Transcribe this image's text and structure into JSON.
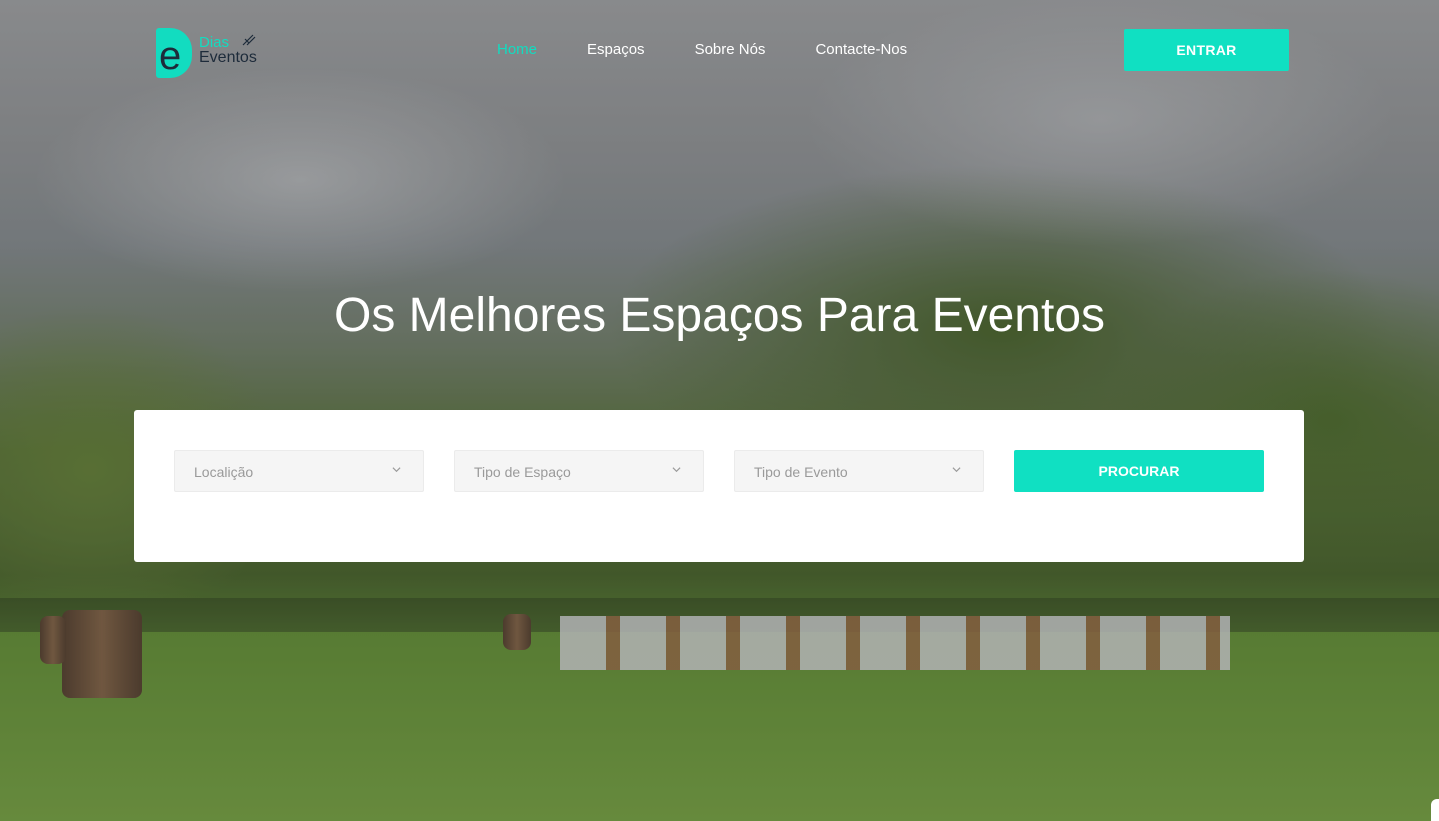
{
  "brand": {
    "name_line1": "Dias",
    "name_line2": "Eventos",
    "mark_letter": "e",
    "accent_color": "#12dcc0",
    "dark_color": "#1d2b3a"
  },
  "nav": {
    "items": [
      {
        "label": "Home",
        "active": true
      },
      {
        "label": "Espaços",
        "active": false
      },
      {
        "label": "Sobre Nós",
        "active": false
      },
      {
        "label": "Contacte-Nos",
        "active": false
      }
    ],
    "login_label": "ENTRAR"
  },
  "hero": {
    "headline": "Os Melhores Espaços Para Eventos"
  },
  "search": {
    "location_placeholder": "Localição",
    "space_type_placeholder": "Tipo de Espaço",
    "event_type_placeholder": "Tipo de Evento",
    "submit_label": "PROCURAR"
  },
  "icons": {
    "chevron": "chevron-down-icon",
    "logo": "brand-logo-icon"
  }
}
